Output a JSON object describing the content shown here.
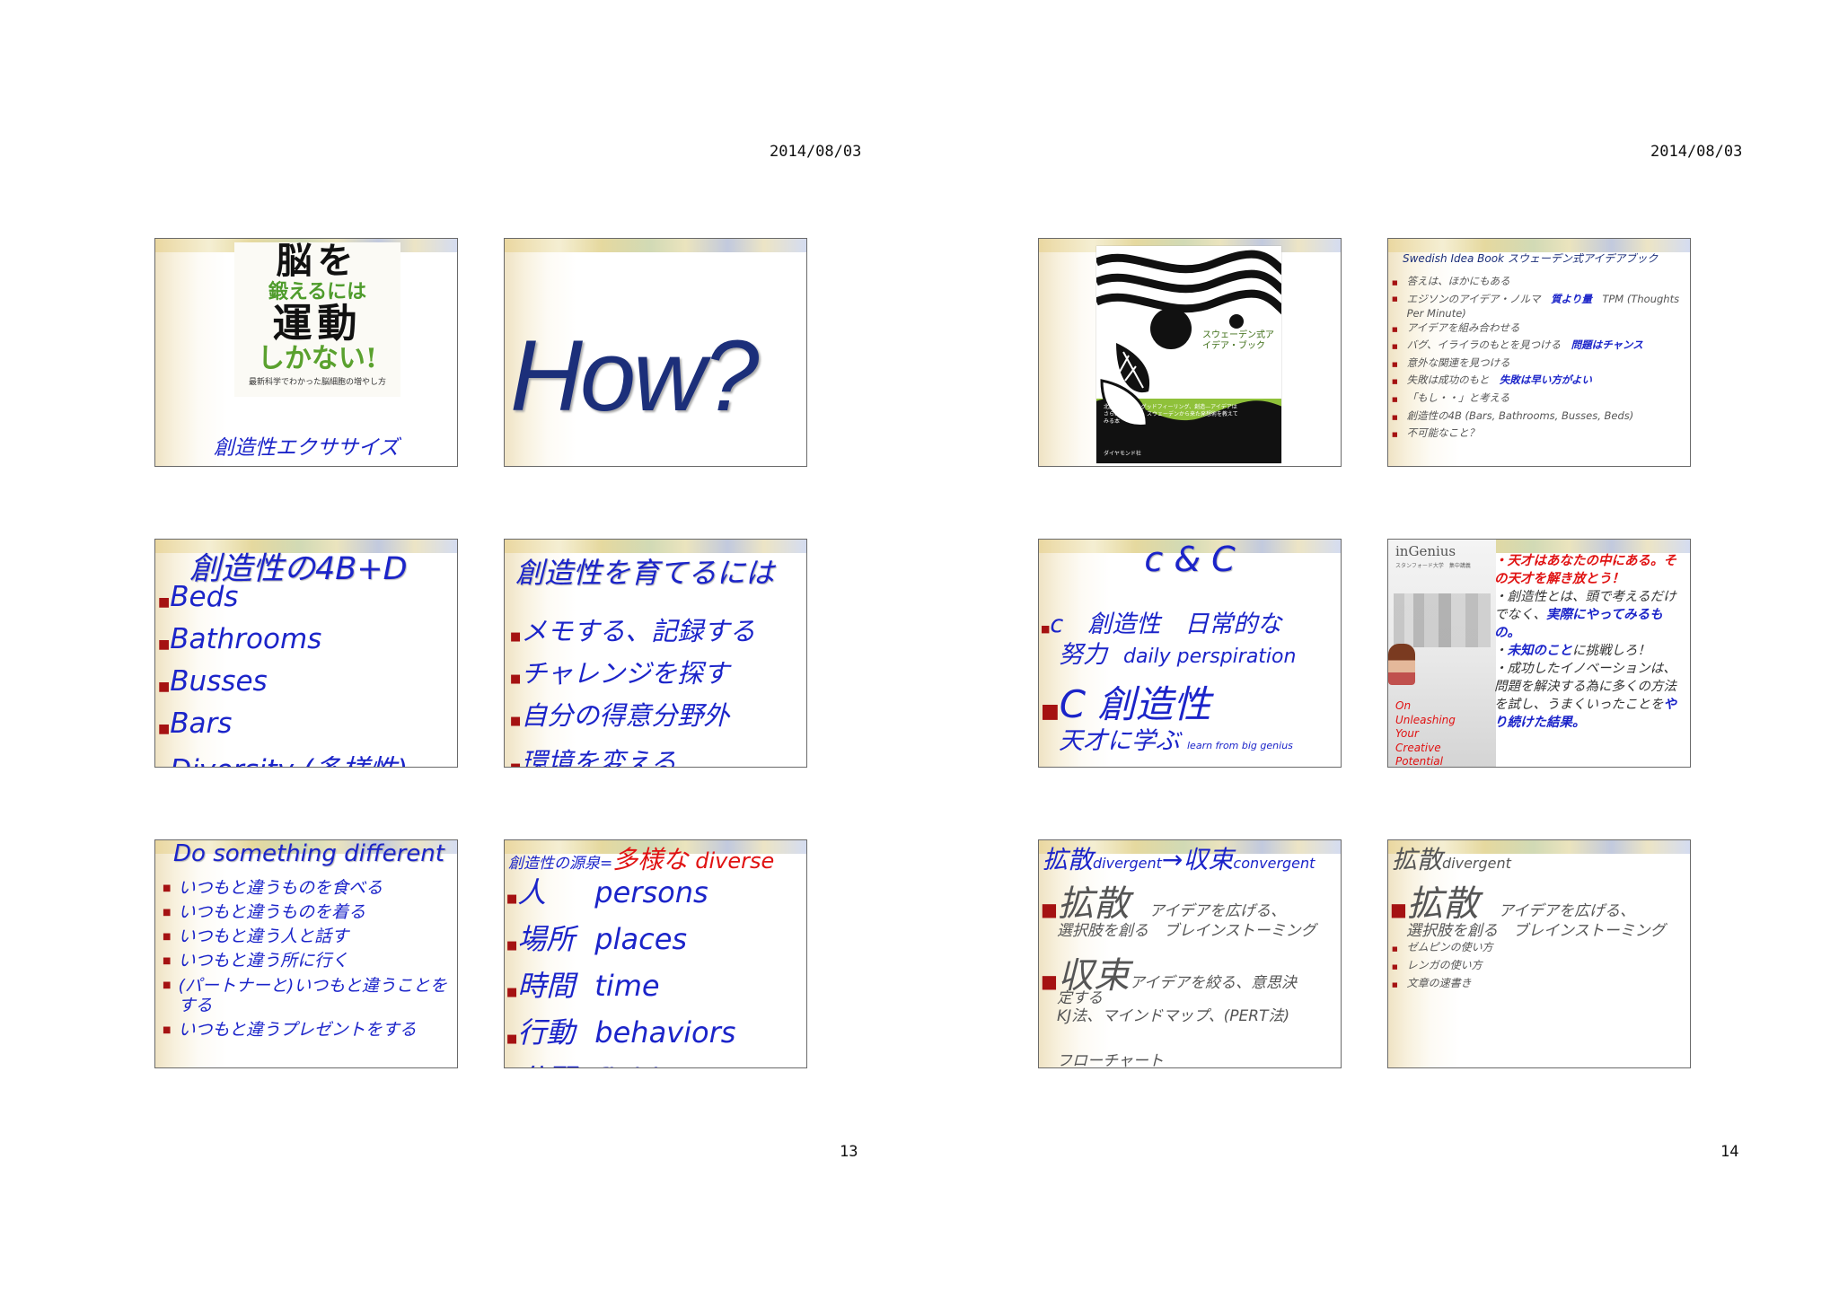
{
  "pages": [
    {
      "date": "2014/08/03",
      "page_number": "13"
    },
    {
      "date": "2014/08/03",
      "page_number": "14"
    }
  ],
  "s1": {
    "cover_line1": "脳を",
    "cover_line2": "鍛えるには",
    "cover_line3": "運動",
    "cover_line4": "しかない!",
    "cover_sub": "最新科学でわかった脳細胞の増やし方",
    "caption": "創造性エクササイズ"
  },
  "s2": {
    "text": "How?"
  },
  "s3": {
    "title": "創造性の4B+D",
    "items": [
      "Beds",
      "Bathrooms",
      "Busses",
      "Bars",
      "Diversity (多様性)"
    ]
  },
  "s4": {
    "title": "創造性を育てるには",
    "items": [
      "メモする、記録する",
      "チャレンジを探す",
      "自分の得意分野外",
      "環境を変える"
    ]
  },
  "s5": {
    "title": "Do something different",
    "items": [
      "いつもと違うものを食べる",
      "いつもと違うものを着る",
      "いつもと違う人と話す",
      "いつもと違う所に行く",
      "(パートナーと)いつもと違うことをする",
      "いつもと違うプレゼントをする"
    ]
  },
  "s6": {
    "title_prefix": "創造性の源泉=",
    "title_jp": "多様な",
    "title_en": "diverse",
    "items": [
      {
        "jp": "人",
        "en": "persons"
      },
      {
        "jp": "場所",
        "en": "places"
      },
      {
        "jp": "時間",
        "en": "time"
      },
      {
        "jp": "行動",
        "en": "behaviors"
      },
      {
        "jp": "分野",
        "en": "fields"
      }
    ]
  },
  "s7": {
    "book_title": "スウェーデン式アイデア・ブック",
    "book_blurb": "北欧デザイン、グッドフィーリング、創造—アイデアはさらに生まれる。スウェーデンから来た発想術を教えてみる本",
    "publisher": "ダイヤモンド社"
  },
  "s8": {
    "title": "Swedish Idea Book スウェーデン式アイデアブック",
    "items": [
      {
        "text": "答えは、ほかにもある"
      },
      {
        "text": "エジソンのアイデア・ノルマ",
        "highlight": "質より量",
        "extra": "TPM (Thoughts Per Minute)"
      },
      {
        "text": "アイデアを組み合わせる"
      },
      {
        "text": "バグ、イライラのもとを見つける",
        "highlight": "問題はチャンス"
      },
      {
        "text": "意外な関連を見つける"
      },
      {
        "text": "失敗は成功のもと",
        "highlight": "失敗は早い方がよい"
      },
      {
        "text": "「もし・・」と考える"
      },
      {
        "text": "創造性の4B (Bars, Bathrooms, Busses, Beds)"
      },
      {
        "text": "不可能なこと？"
      }
    ]
  },
  "s9": {
    "title": "c & C",
    "line1": "c　創造性　日常的な",
    "line2": "努力",
    "line2_en": "daily perspiration",
    "line3": "C 創造性",
    "line4": "天才に学ぶ",
    "line4_en": "learn from big genius"
  },
  "s10": {
    "book_title": "inGenius",
    "book_subtitle": "スタンフォード大学　集中講義",
    "side_text": "On Unleashing Your Creative Potential",
    "heading": "・天才はあなたの中にある。その天才を解き放とう！",
    "body1_a": "・創造性とは、頭で考えるだけでなく、",
    "body1_b": "実際にやってみるもの。",
    "body2_a": "・",
    "body2_b": "未知のこと",
    "body2_c": "に挑戦しろ！",
    "body3_a": "・成功したイノベーションは、問題を解決する為に多くの方法を試し、うまくいったことを",
    "body3_b": "やり続けた結果。"
  },
  "s11": {
    "title_a": "拡散",
    "title_a_en": "divergent",
    "title_arrow": "→",
    "title_b": "収束",
    "title_b_en": "convergent",
    "b1_big": "拡散",
    "b1_desc": "アイデアを広げる、",
    "b1_line2": "選択肢を創る　ブレインストーミング",
    "b2_big": "収束",
    "b2_desc": "アイデアを絞る、意思決",
    "b2_line2": "定する",
    "b2_line3": "KJ法、マインドマップ、(PERT法)",
    "b2_line4": "フローチャート"
  },
  "s12": {
    "title": "拡散",
    "title_en": "divergent",
    "b1_big": "拡散",
    "b1_desc": "アイデアを広げる、",
    "b1_line2": "選択肢を創る　ブレインストーミング",
    "items": [
      "ゼムピンの使い方",
      "レンガの使い方",
      "文章の速書き"
    ]
  }
}
